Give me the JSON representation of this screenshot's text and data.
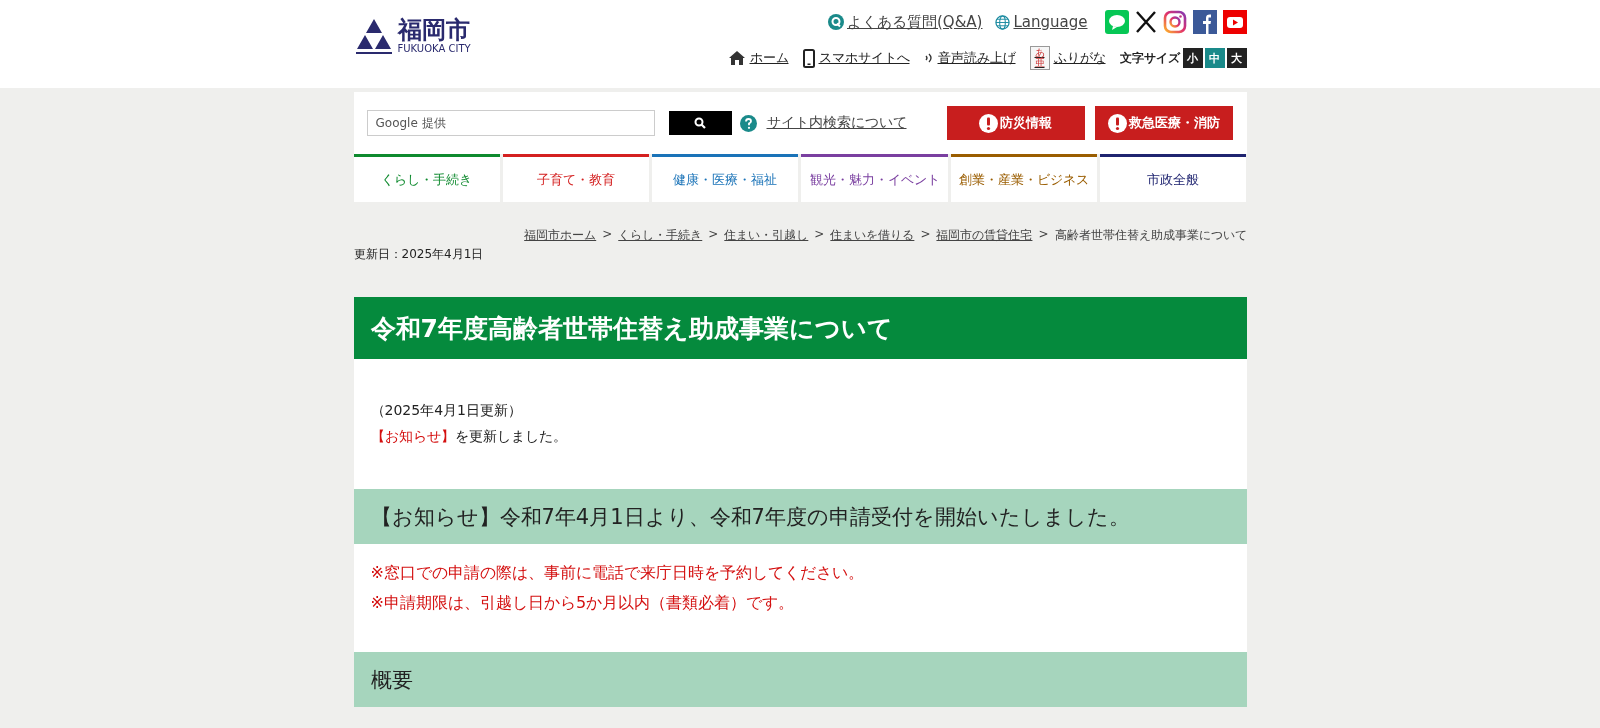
{
  "header": {
    "logo": {
      "name": "福岡市",
      "sub": "FUKUOKA CITY"
    },
    "top_links": [
      {
        "label": "よくある質問(Q&A)",
        "kind": "faq"
      },
      {
        "label": "Language",
        "kind": "globe"
      }
    ],
    "utility_links": [
      {
        "label": "ホーム",
        "kind": "home"
      },
      {
        "label": "スマホサイトへ",
        "kind": "phone"
      },
      {
        "label": "音声読み上げ",
        "kind": "voice"
      },
      {
        "label": "ふりがな",
        "kind": "furigana",
        "icon_chars": "あ亜"
      }
    ],
    "font_size": {
      "label": "文字サイズ",
      "options": [
        {
          "label": "小",
          "selected": false
        },
        {
          "label": "中",
          "selected": true
        },
        {
          "label": "大",
          "selected": false
        }
      ]
    }
  },
  "search": {
    "placeholder": "Google 提供",
    "help": "サイト内検索について"
  },
  "emergency_buttons": [
    "防災情報",
    "救急医療・消防"
  ],
  "nav": [
    {
      "label": "くらし・手続き",
      "color": "#0e8a2e"
    },
    {
      "label": "子育て・教育",
      "color": "#d42020"
    },
    {
      "label": "健康・医療・福祉",
      "color": "#1a73b8"
    },
    {
      "label": "観光・魅力・イベント",
      "color": "#7a3fa0"
    },
    {
      "label": "創業・産業・ビジネス",
      "color": "#9a5d00"
    },
    {
      "label": "市政全般",
      "color": "#1f2470"
    }
  ],
  "breadcrumb": {
    "separator": ">",
    "items": [
      {
        "label": "福岡市ホーム",
        "link": true
      },
      {
        "label": "くらし・手続き",
        "link": true
      },
      {
        "label": "住まい・引越し",
        "link": true
      },
      {
        "label": "住まいを借りる",
        "link": true
      },
      {
        "label": "福岡市の賃貸住宅",
        "link": true
      },
      {
        "label": "高齢者世帯住替え助成事業について",
        "link": false
      }
    ]
  },
  "updated": "更新日：2025年4月1日",
  "page_title": "令和7年度高齢者世帯住替え助成事業について",
  "intro": {
    "date": "（2025年4月1日更新）",
    "notice": "【お知らせ】",
    "text": "を更新しました。"
  },
  "sections": [
    {
      "heading": "【お知らせ】令和7年4月1日より、令和7年度の申請受付を開始いたしました。",
      "notes": [
        "※窓口での申請の際は、事前に電話で来庁日時を予約してください。",
        "※申請期限は、引越し日から5か月以内（書類必着）です。"
      ]
    },
    {
      "heading": "概要"
    }
  ]
}
